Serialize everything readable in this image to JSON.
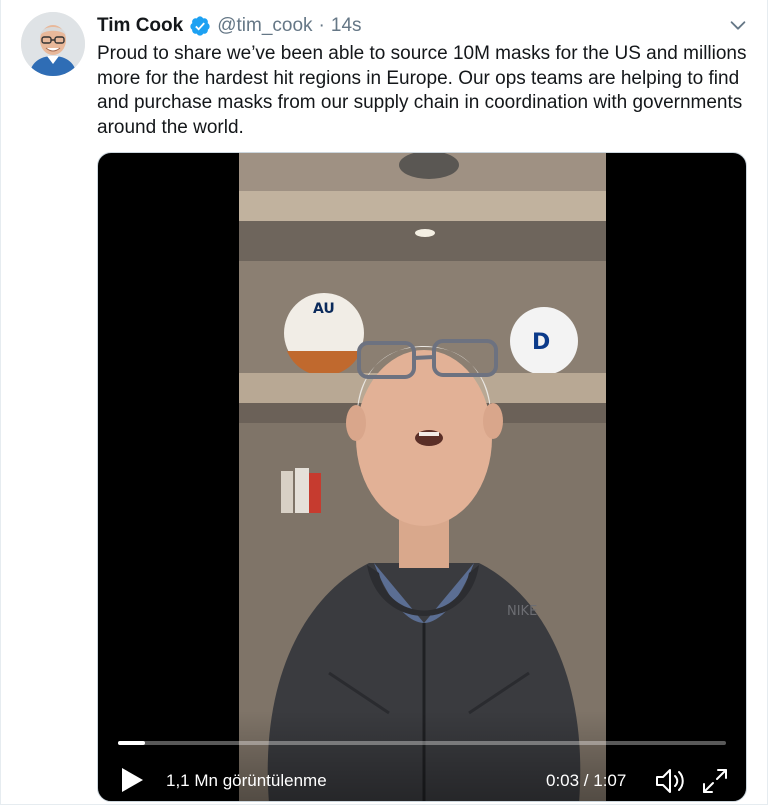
{
  "tweet": {
    "name": "Tim Cook",
    "handle": "@tim_cook",
    "separator": "·",
    "time": "14s",
    "verified": true,
    "text": "Proud to share we’ve been able to source 10M masks for the US and millions more for the hardest hit regions in Europe. Our ops teams are helping to find and purchase masks from our supply chain in coordination with governments around the world.",
    "icons": {
      "verified": "verified-badge-icon",
      "menu": "chevron-down-icon"
    }
  },
  "video": {
    "views": "1,1 Mn görüntülenme",
    "timecode": "0:03 / 1:07",
    "progress_fraction": 0.045,
    "icons": {
      "play": "play-icon",
      "volume": "volume-icon",
      "fullscreen": "fullscreen-icon"
    }
  },
  "colors": {
    "verified_blue": "#1da1f2",
    "text": "#14171a",
    "secondary": "#657786"
  }
}
